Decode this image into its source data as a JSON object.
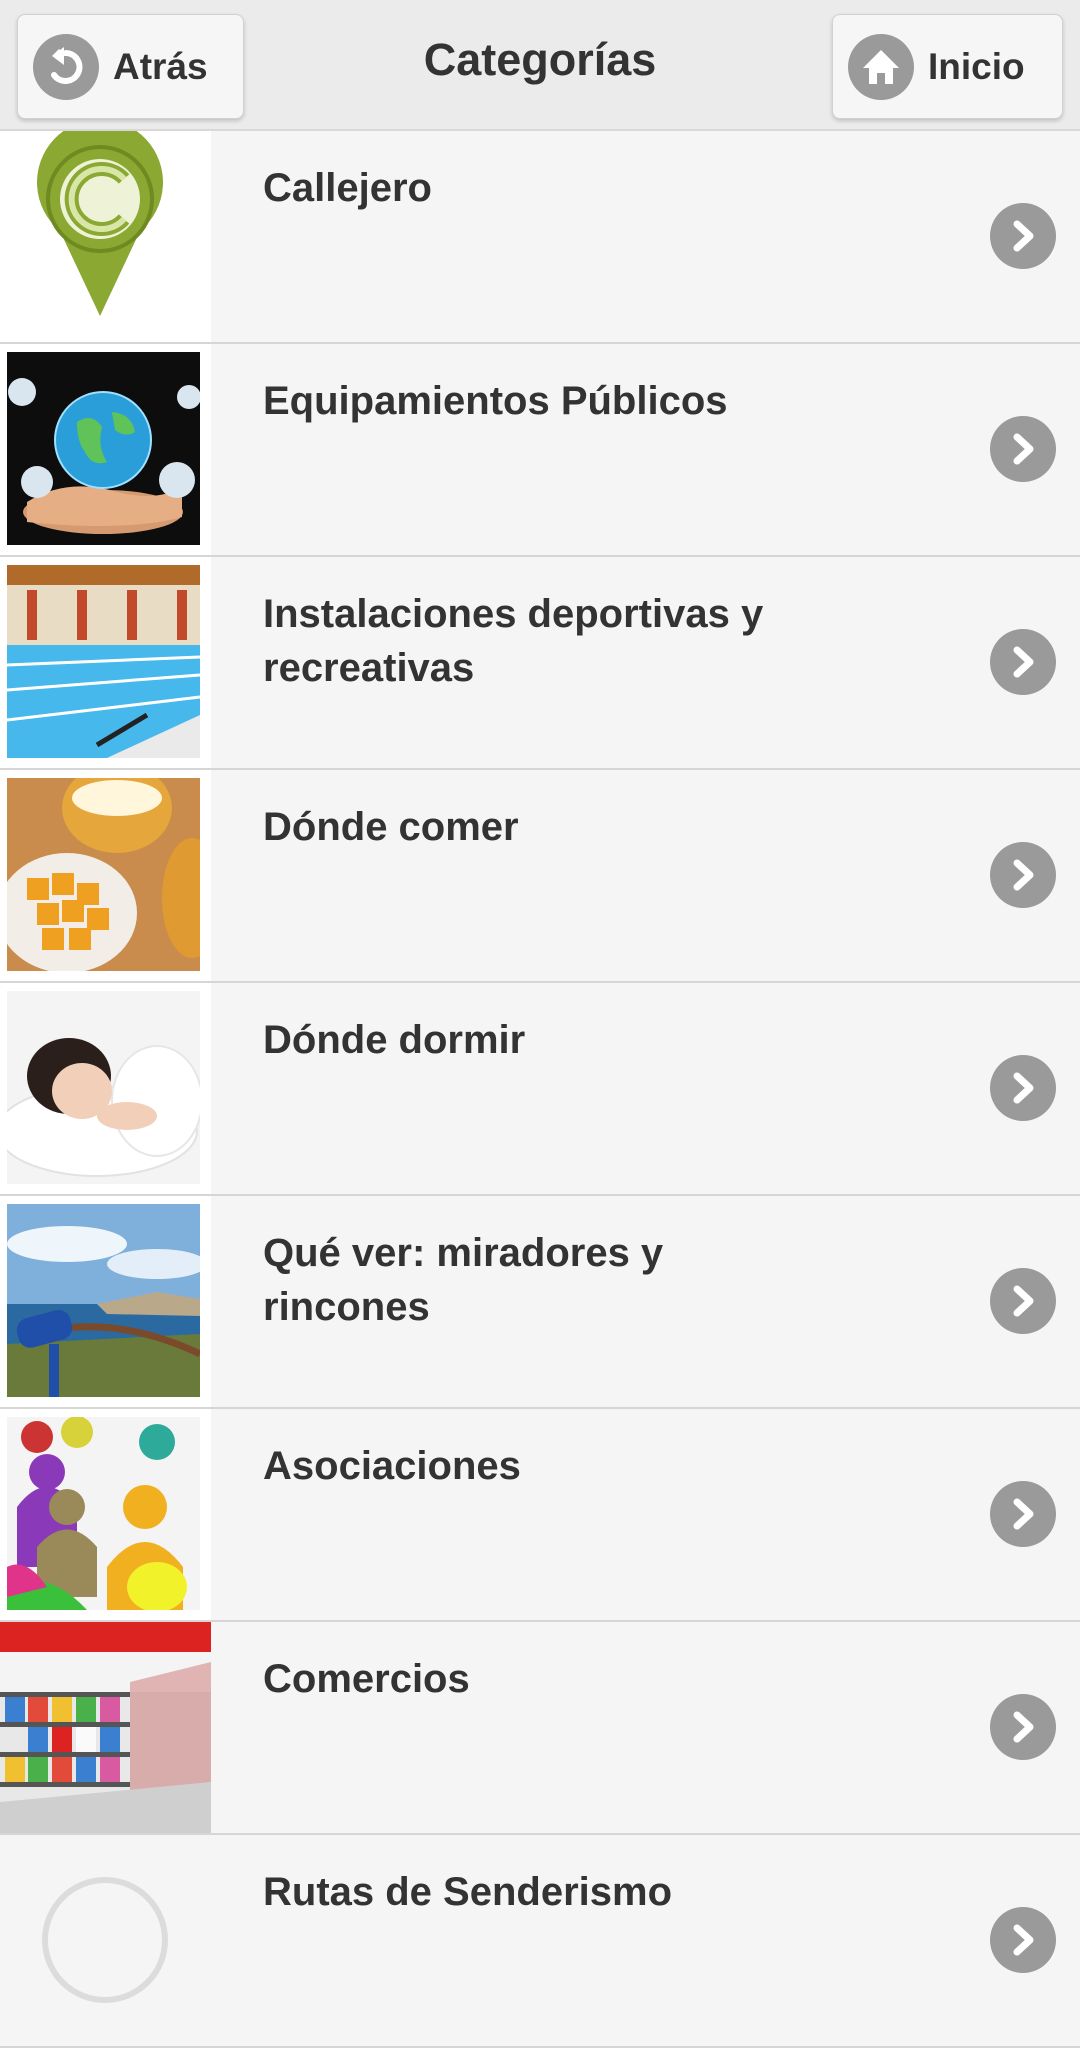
{
  "header": {
    "back_label": "Atrás",
    "title": "Categorías",
    "home_label": "Inicio"
  },
  "categories": [
    {
      "label": "Callejero",
      "icon": "map-pin-icon"
    },
    {
      "label": "Equipamientos Públicos",
      "icon": "globe-image"
    },
    {
      "label": "Instalaciones deportivas y recreativas",
      "icon": "swimming-pool-image"
    },
    {
      "label": "Dónde comer",
      "icon": "food-drinks-image"
    },
    {
      "label": "Dónde dormir",
      "icon": "sleeping-person-image"
    },
    {
      "label": "Qué ver: miradores y rincones",
      "icon": "viewpoint-telescope-image"
    },
    {
      "label": "Asociaciones",
      "icon": "people-group-image"
    },
    {
      "label": "Comercios",
      "icon": "store-shelves-image"
    },
    {
      "label": "Rutas de Senderismo",
      "icon": "hiking-image"
    }
  ],
  "colors": {
    "header_bg": "#ebebeb",
    "list_bg": "#f5f5f5",
    "text": "#333333",
    "icon_gray": "#9a9a9a",
    "pin_green": "#8aa832"
  }
}
